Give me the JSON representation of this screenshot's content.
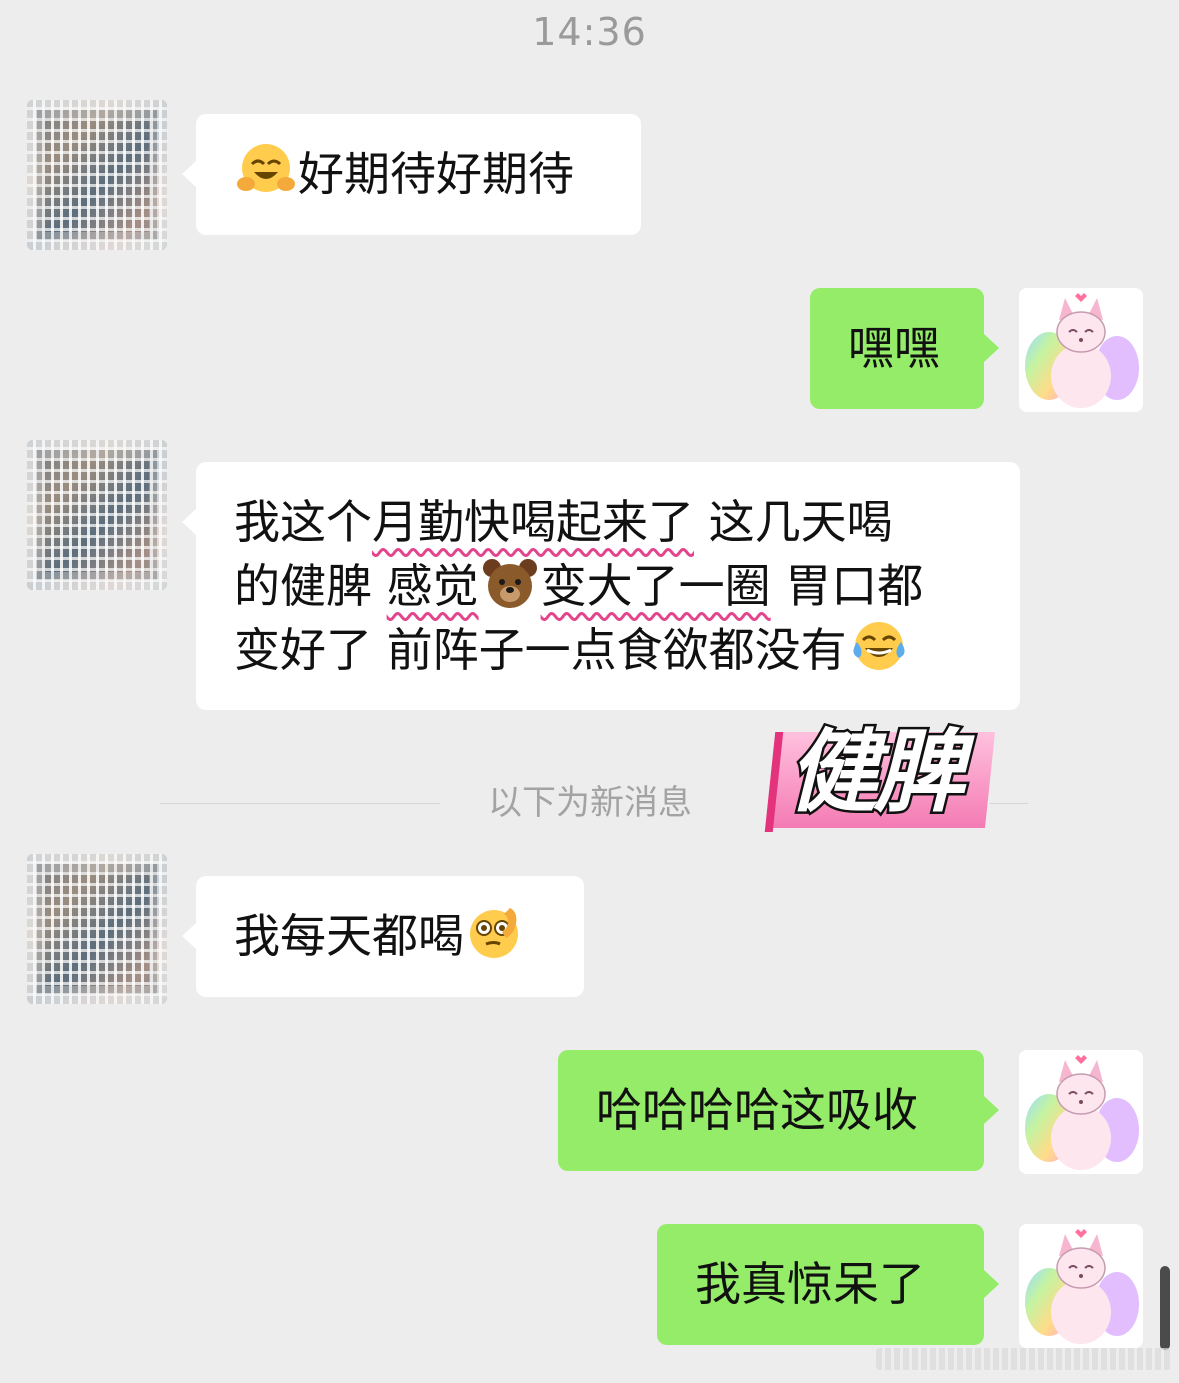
{
  "chat": {
    "timestamp": "14:36",
    "messages": [
      {
        "side": "in",
        "text": "好期待好期待",
        "lead_emoji": "hugging-face-emoji"
      },
      {
        "side": "out",
        "text": "嘿嘿"
      },
      {
        "side": "in",
        "lines": [
          [
            "我这个",
            "月勤快喝起来了",
            " 这几天喝"
          ],
          [
            "的健脾 ",
            "感觉",
            "🐻",
            "变大了一圈",
            " 胃口都"
          ],
          [
            "变好了 前阵子一点食欲都没有",
            "😂"
          ]
        ],
        "line_1_a": "我这个",
        "line_1_b": "月勤快喝起来了",
        "line_1_c": " 这几天喝",
        "line_2_a": "的健脾 ",
        "line_2_b": "感觉",
        "line_2_c": "变大了一圈",
        "line_2_d": " 胃口都",
        "line_3_a": "变好了 前阵子一点食欲都没有"
      },
      {
        "side": "in",
        "text": "我每天都喝",
        "trail_emoji": "face-with-monocle-hand-emoji"
      },
      {
        "side": "out",
        "text": "哈哈哈哈这吸收"
      },
      {
        "side": "out",
        "text": "我真惊呆了"
      }
    ],
    "new_messages_divider": "以下为新消息",
    "sticker_text": "健脾"
  },
  "colors": {
    "background": "#ededed",
    "incoming_bubble": "#ffffff",
    "outgoing_bubble": "#95ec69",
    "wavy_underline": "#e2458e",
    "sticker_pink": "#f47bb4"
  }
}
